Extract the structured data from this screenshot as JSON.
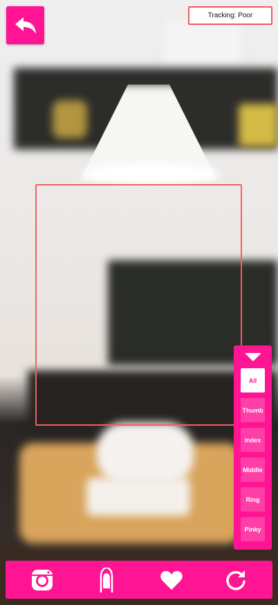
{
  "colors": {
    "accent": "#ff1493",
    "accent_light": "#ff3fa8",
    "tracking_border": "#f05a5a"
  },
  "header": {
    "back_icon": "back-arrow-icon",
    "tracking_status": "Tracking: Poor"
  },
  "finger_selector": {
    "collapse_icon": "triangle-down-icon",
    "options": [
      {
        "label": "All",
        "selected": true
      },
      {
        "label": "Thumb",
        "selected": false
      },
      {
        "label": "Index",
        "selected": false
      },
      {
        "label": "Middle",
        "selected": false
      },
      {
        "label": "Ring",
        "selected": false
      },
      {
        "label": "Pinky",
        "selected": false
      }
    ]
  },
  "toolbar": {
    "items": [
      {
        "icon": "instagram-icon"
      },
      {
        "icon": "nail-finger-icon"
      },
      {
        "icon": "heart-icon"
      },
      {
        "icon": "refresh-icon"
      }
    ]
  }
}
